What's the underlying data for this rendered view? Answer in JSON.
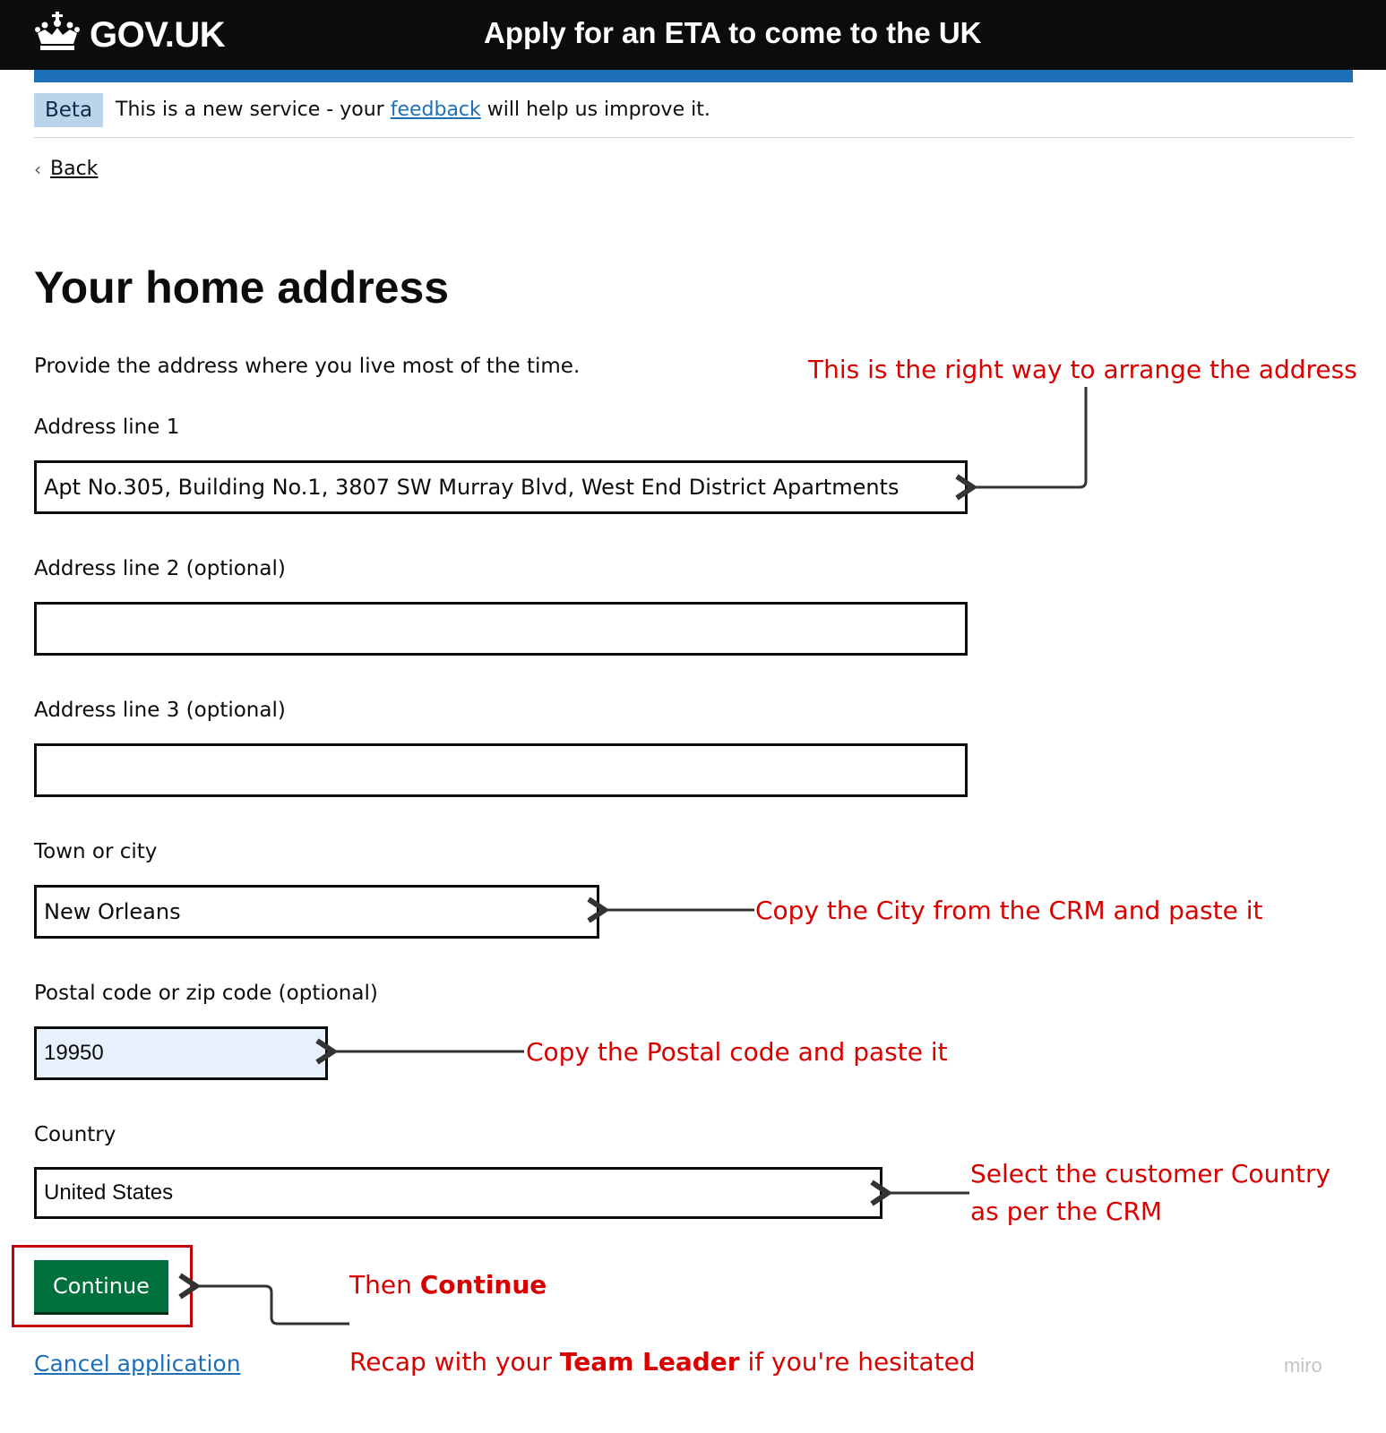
{
  "header": {
    "logo_text": "GOV.UK",
    "logo_icon": "crown-icon",
    "service_name": "Apply for an ETA to come to the UK"
  },
  "phase_banner": {
    "tag": "Beta",
    "text_before": "This is a new service - your ",
    "link": "feedback",
    "text_after": " will help us improve it."
  },
  "back_link": "Back",
  "page_title": "Your home address",
  "hint": "Provide the address where you live most of the time.",
  "form": {
    "address_line_1": {
      "label": "Address line 1",
      "value": "Apt No.305, Building No.1, 3807 SW Murray Blvd, West End District Apartments"
    },
    "address_line_2": {
      "label": "Address line 2 (optional)",
      "value": ""
    },
    "address_line_3": {
      "label": "Address line 3 (optional)",
      "value": ""
    },
    "town": {
      "label": "Town or city",
      "value": "New Orleans"
    },
    "postcode": {
      "label": "Postal code or zip code (optional)",
      "value": "19950"
    },
    "country": {
      "label": "Country",
      "value": "United States"
    }
  },
  "continue_label": "Continue",
  "cancel_label": "Cancel application",
  "annotations": {
    "address": "This is the right way to arrange the address",
    "city": "Copy the City from the CRM and paste it",
    "postcode": "Copy the Postal code and paste it",
    "country_line1": "Select the customer Country",
    "country_line2": "as per the CRM",
    "continue_prefix": "Then ",
    "continue_bold": "Continue",
    "recap_prefix": "Recap with your ",
    "recap_bold": "Team Leader",
    "recap_suffix": " if you're hesitated"
  },
  "watermark": "miro",
  "colors": {
    "header_bg": "#0b0c0c",
    "brand_blue": "#1d70b8",
    "button_green": "#00703c",
    "annotation_red": "#d90000",
    "beta_tag_bg": "#bbd4ea",
    "autofill_bg": "#e8f0fe"
  }
}
